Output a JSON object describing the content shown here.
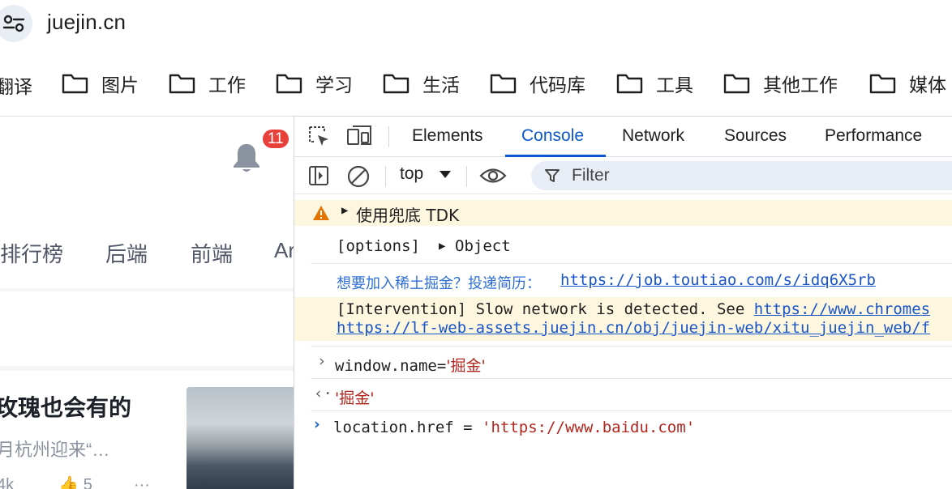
{
  "browser": {
    "url": "juejin.cn",
    "bookmarks_first": "翻译",
    "bookmarks": [
      "图片",
      "工作",
      "学习",
      "生活",
      "代码库",
      "工具",
      "其他工作",
      "媒体"
    ]
  },
  "page": {
    "notification_count": "11",
    "nav": [
      "排行榜",
      "后端",
      "前端",
      "Ar"
    ],
    "article": {
      "title": "玫瑰也会有的",
      "desc": "月杭州迎来“…",
      "meta_views": "4k",
      "meta_likes": "5",
      "meta_more": "···"
    }
  },
  "devtools": {
    "tabs": [
      "Elements",
      "Console",
      "Network",
      "Sources",
      "Performance"
    ],
    "active_tab": "Console",
    "context": "top",
    "filter_placeholder": "Filter",
    "messages": {
      "warn_group": "使用兜底 TDK",
      "options_key": "[options]",
      "options_val": "Object",
      "recruit_text": "想要加入稀土掘金？投递简历：",
      "recruit_link": "https://job.toutiao.com/s/idq6X5rb",
      "intervention_text": "[Intervention] Slow network is detected. See ",
      "intervention_link": "https://www.chromes",
      "intervention_link2": "https://lf-web-assets.juejin.cn/obj/juejin-web/xitu_juejin_web/f",
      "input1_code": "window.name=",
      "input1_str": "'掘金'",
      "output1": "'掘金'",
      "input2_code": "location.href = ",
      "input2_str": "'https://www.baidu.com'"
    }
  },
  "colors": {
    "accent": "#0b57d0",
    "warning_bg": "#fef7e0",
    "badge": "#e8413c",
    "string": "#b3261e"
  }
}
